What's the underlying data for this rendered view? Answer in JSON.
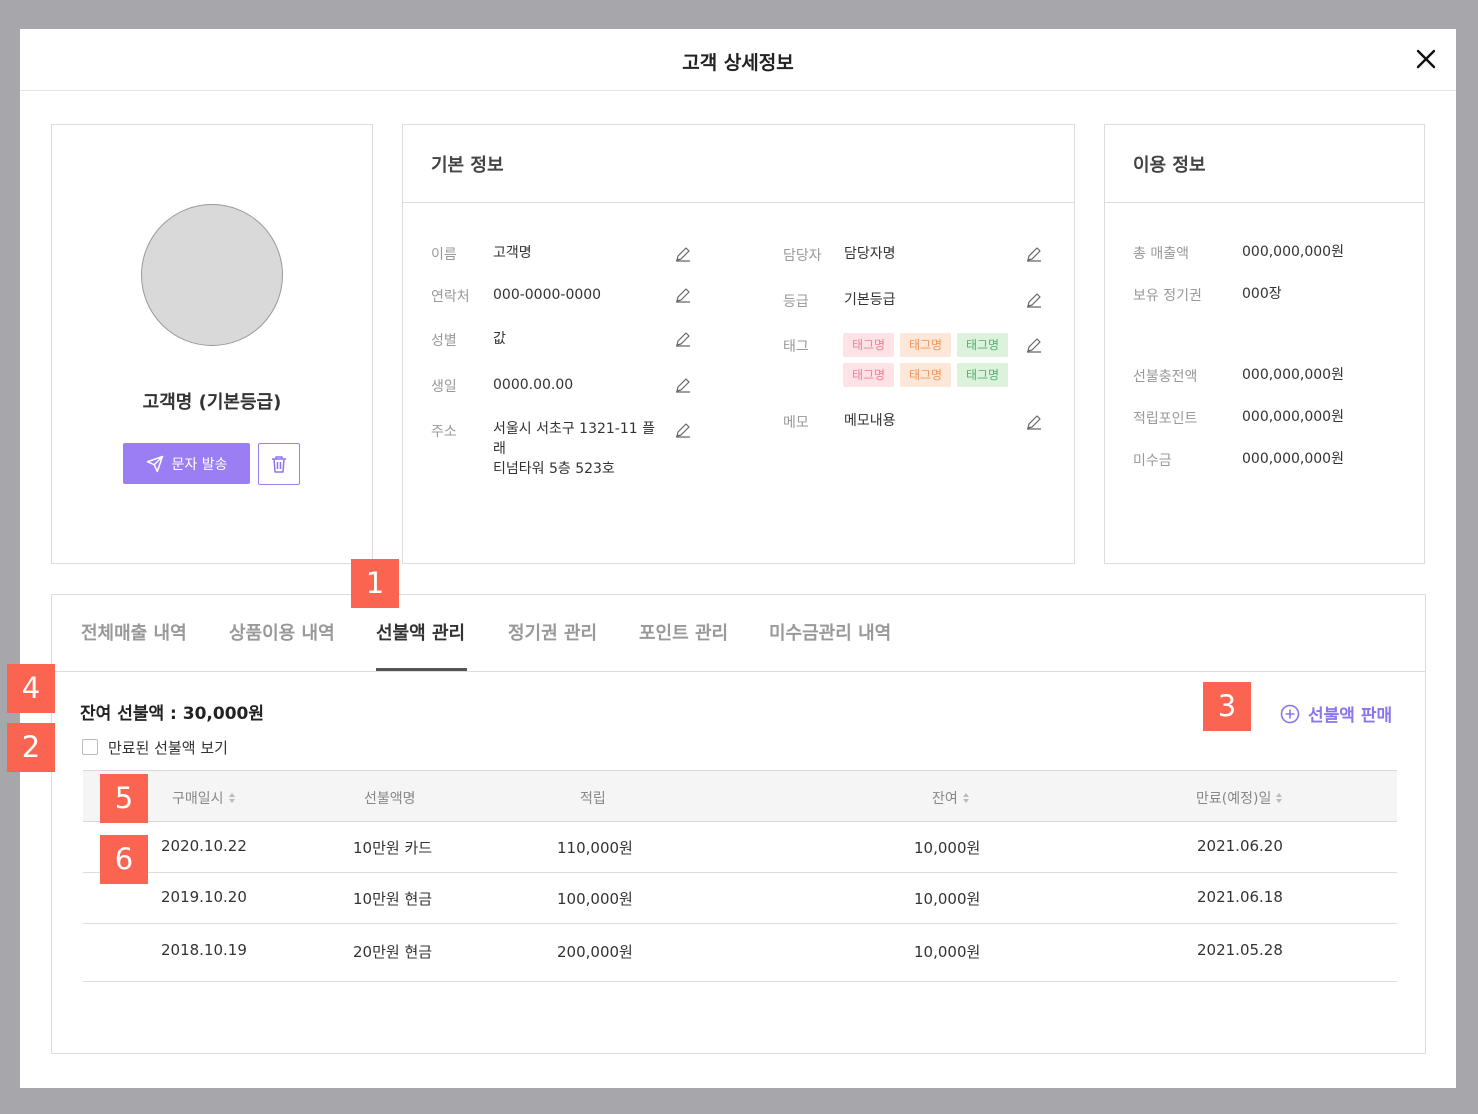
{
  "modal": {
    "title": "고객 상세정보",
    "close_icon": "close-icon"
  },
  "profile": {
    "name": "고객명 (기본등급)",
    "sms_label": "문자 발송",
    "delete_icon": "trash-icon"
  },
  "basic": {
    "title": "기본 정보",
    "left": [
      {
        "label": "이름",
        "value": "고객명"
      },
      {
        "label": "연락처",
        "value": "000-0000-0000"
      },
      {
        "label": "성별",
        "value": "값"
      },
      {
        "label": "생일",
        "value": "0000.00.00"
      },
      {
        "label": "주소",
        "value": "서울시 서초구 1321-11 플래\n티넘타워 5층 523호"
      }
    ],
    "right": [
      {
        "label": "담당자",
        "value": "담당자명"
      },
      {
        "label": "등급",
        "value": "기본등급"
      },
      {
        "label": "태그",
        "value": ""
      },
      {
        "label": "메모",
        "value": "메모내용"
      }
    ],
    "tags": [
      {
        "label": "태그명",
        "color": "#f27c8f"
      },
      {
        "label": "태그명",
        "color": "#f29458"
      },
      {
        "label": "태그명",
        "color": "#4fb06c"
      },
      {
        "label": "태그명",
        "color": "#f27c8f"
      },
      {
        "label": "태그명",
        "color": "#f29458"
      },
      {
        "label": "태그명",
        "color": "#4fb06c"
      }
    ]
  },
  "usage": {
    "title": "이용 정보",
    "items": [
      {
        "label": "총 매출액",
        "value": "000,000,000원"
      },
      {
        "label": "보유 정기권",
        "value": "000장"
      },
      {
        "label": "선불충전액",
        "value": "000,000,000원"
      },
      {
        "label": "적립포인트",
        "value": "000,000,000원"
      },
      {
        "label": "미수금",
        "value": "000,000,000원"
      }
    ]
  },
  "tabs": [
    {
      "label": "전체매출 내역",
      "active": false
    },
    {
      "label": "상품이용 내역",
      "active": false
    },
    {
      "label": "선불액 관리",
      "active": true
    },
    {
      "label": "정기권 관리",
      "active": false
    },
    {
      "label": "포인트 관리",
      "active": false
    },
    {
      "label": "미수금관리 내역",
      "active": false
    }
  ],
  "prepaid": {
    "balance_text": "잔여 선불액 : 30,000원",
    "expired_checkbox_label": "만료된 선불액 보기",
    "expired_checked": false,
    "sell_label": "선불액 판매",
    "accent_color": "#8d74ef"
  },
  "table": {
    "headers": [
      "구매일시",
      "선불액명",
      "적립",
      "잔여",
      "만료(예정)일"
    ],
    "rows": [
      [
        "2020.10.22",
        "10만원 카드",
        "110,000원",
        "10,000원",
        "2021.06.20"
      ],
      [
        "2019.10.20",
        "10만원 현금",
        "100,000원",
        "10,000원",
        "2021.06.18"
      ],
      [
        "2018.10.19",
        "20만원 현금",
        "200,000원",
        "10,000원",
        "2021.05.28"
      ]
    ]
  },
  "annotations": [
    "1",
    "2",
    "3",
    "4",
    "5",
    "6"
  ]
}
